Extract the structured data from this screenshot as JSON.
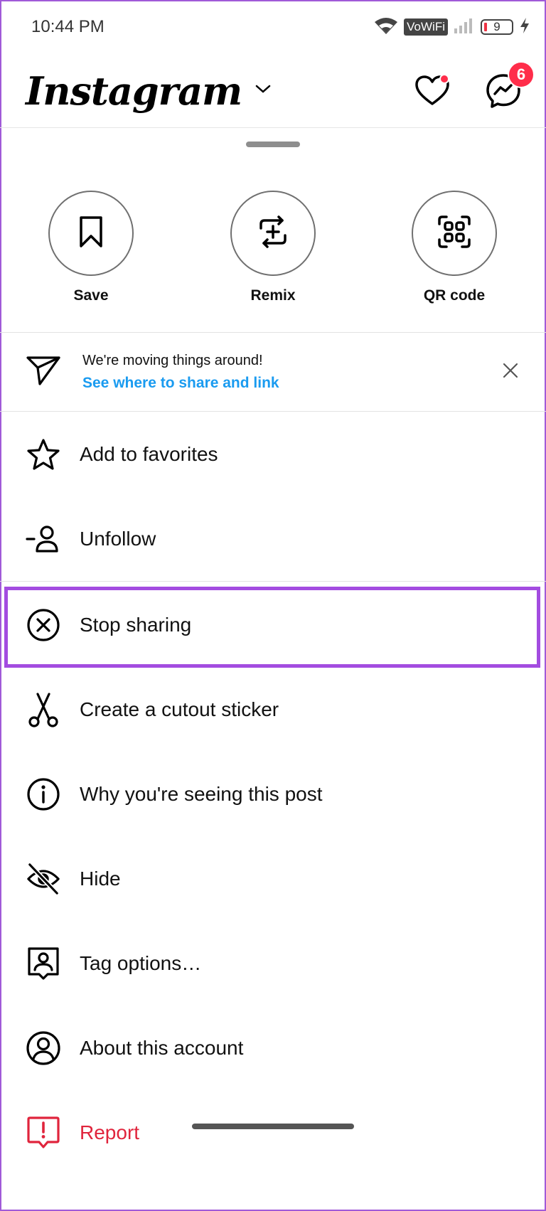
{
  "status_bar": {
    "time": "10:44 PM",
    "vowifi_label": "VoWiFi",
    "battery_level": "9"
  },
  "header": {
    "brand": "Instagram",
    "messages_badge": "6"
  },
  "quick_actions": [
    {
      "label": "Save",
      "icon": "bookmark-icon"
    },
    {
      "label": "Remix",
      "icon": "remix-icon"
    },
    {
      "label": "QR code",
      "icon": "qr-code-icon"
    }
  ],
  "notice": {
    "title": "We're moving things around!",
    "link": "See where to share and link"
  },
  "menu": [
    {
      "label": "Add to favorites",
      "icon": "star-icon"
    },
    {
      "label": "Unfollow",
      "icon": "unfollow-icon"
    },
    {
      "label": "Stop sharing",
      "icon": "circle-x-icon"
    },
    {
      "label": "Create a cutout sticker",
      "icon": "scissors-icon"
    },
    {
      "label": "Why you're seeing this post",
      "icon": "info-icon"
    },
    {
      "label": "Hide",
      "icon": "eye-off-icon"
    },
    {
      "label": "Tag options…",
      "icon": "tag-options-icon"
    },
    {
      "label": "About this account",
      "icon": "account-icon"
    },
    {
      "label": "Report",
      "icon": "report-icon"
    }
  ],
  "colors": {
    "accent_link": "#1a9bf0",
    "danger": "#e0243c",
    "badge": "#ff2d4a",
    "highlight": "#a34ce0"
  }
}
